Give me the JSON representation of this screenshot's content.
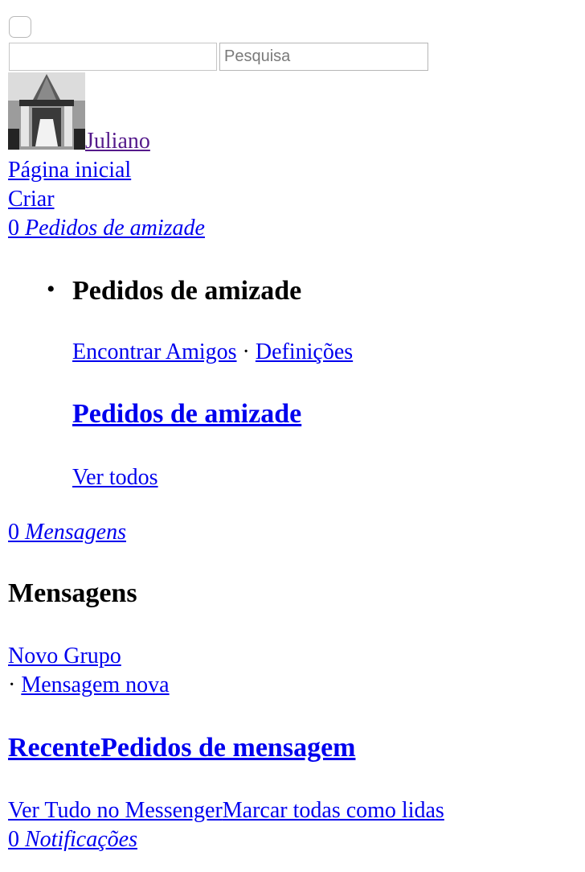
{
  "header": {
    "search_placeholder": "Pesquisa",
    "text_field_value": ""
  },
  "profile": {
    "name": "Juliano",
    "avatar_icon": "wedding-venue-photo"
  },
  "nav": {
    "home": "Página inicial",
    "create": "Criar"
  },
  "friend_requests": {
    "count": "0",
    "link_label": "Pedidos de amizade",
    "menu_title": "Pedidos de amizade",
    "find_friends": "Encontrar Amigos",
    "separator": "·",
    "settings": "Definições",
    "heading": "Pedidos de amizade",
    "see_all": "Ver todos"
  },
  "messages": {
    "count": "0",
    "link_label": "Mensagens",
    "title": "Mensagens",
    "new_group": "Novo Grupo",
    "separator": "·",
    "new_message": "Mensagem nova",
    "tab_recent": "Recente",
    "tab_requests": "Pedidos de mensagem",
    "see_all_messenger": "Ver Tudo no Messenger",
    "mark_all_read": "Marcar todas como lidas"
  },
  "notifications": {
    "count": "0",
    "link_label": "Notificações"
  },
  "colors": {
    "link": "#0000ee",
    "visited_link": "#551a8b"
  }
}
